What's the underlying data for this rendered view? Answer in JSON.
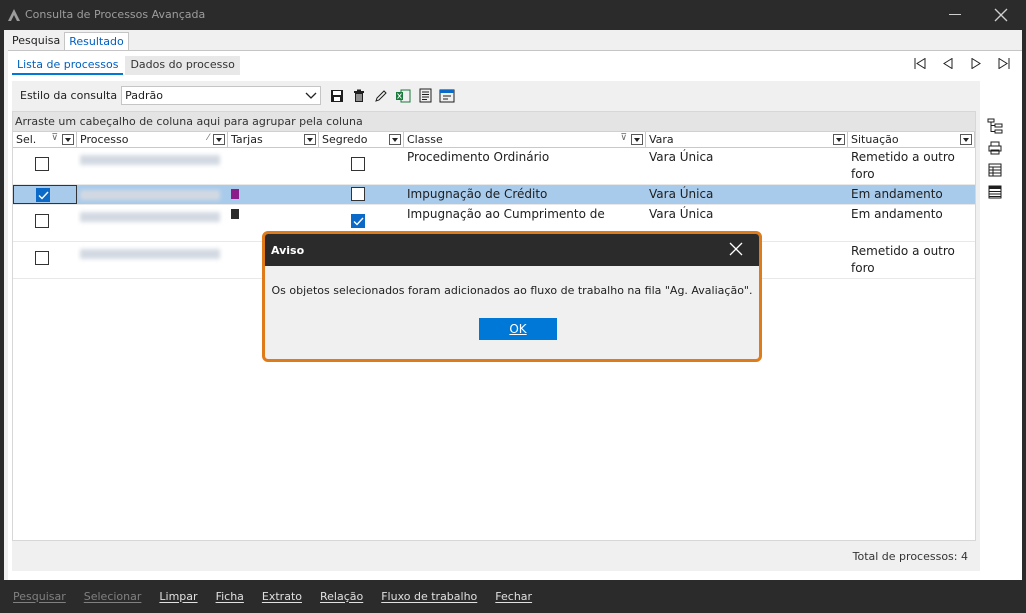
{
  "window": {
    "title": "Consulta de Processos Avançada"
  },
  "top_tabs": [
    {
      "label": "Pesquisa",
      "active": false
    },
    {
      "label": "Resultado",
      "active": true
    }
  ],
  "sub_tabs": [
    {
      "label": "Lista de processos",
      "active": true
    },
    {
      "label": "Dados do processo",
      "active": false
    }
  ],
  "toolbar": {
    "style_label": "Estilo da consulta",
    "style_value": "Padrão",
    "icons": [
      "save-icon",
      "delete-icon",
      "edit-icon",
      "excel-icon",
      "document-icon",
      "window-icon"
    ]
  },
  "grid": {
    "group_hint": "Arraste um cabeçalho de coluna aqui para agrupar pela coluna",
    "columns": [
      "Sel.",
      "Processo",
      "Tarjas",
      "Segredo",
      "Classe",
      "Vara",
      "Situação"
    ],
    "rows": [
      {
        "sel": false,
        "tarja": "",
        "segredo": false,
        "classe": "Procedimento Ordinário",
        "vara": "Vara Única",
        "situacao": "Remetido a outro foro"
      },
      {
        "sel": true,
        "tarja": "#8b1d8b",
        "segredo": false,
        "classe": "Impugnação de Crédito",
        "vara": "Vara Única",
        "situacao": "Em andamento"
      },
      {
        "sel": false,
        "tarja": "#2b2b2b",
        "segredo": true,
        "classe": "Impugnação ao Cumprimento de",
        "vara": "Vara Única",
        "situacao": "Em andamento"
      },
      {
        "sel": false,
        "tarja": "",
        "segredo": false,
        "classe": "",
        "vara": "",
        "situacao": "Remetido a outro foro"
      }
    ],
    "total_label": "Total de processos: 4"
  },
  "bottom_buttons": [
    {
      "label": "Pesquisar",
      "disabled": true
    },
    {
      "label": "Selecionar",
      "disabled": true
    },
    {
      "label": "Limpar",
      "disabled": false
    },
    {
      "label": "Ficha",
      "disabled": false
    },
    {
      "label": "Extrato",
      "disabled": false
    },
    {
      "label": "Relação",
      "disabled": false
    },
    {
      "label": "Fluxo de trabalho",
      "disabled": false
    },
    {
      "label": "Fechar",
      "disabled": false
    }
  ],
  "dialog": {
    "title": "Aviso",
    "message": "Os objetos selecionados foram adicionados ao fluxo de trabalho na fila \"Ag. Avaliação\".",
    "ok_label": "OK",
    "border_color": "#e07b1a"
  }
}
